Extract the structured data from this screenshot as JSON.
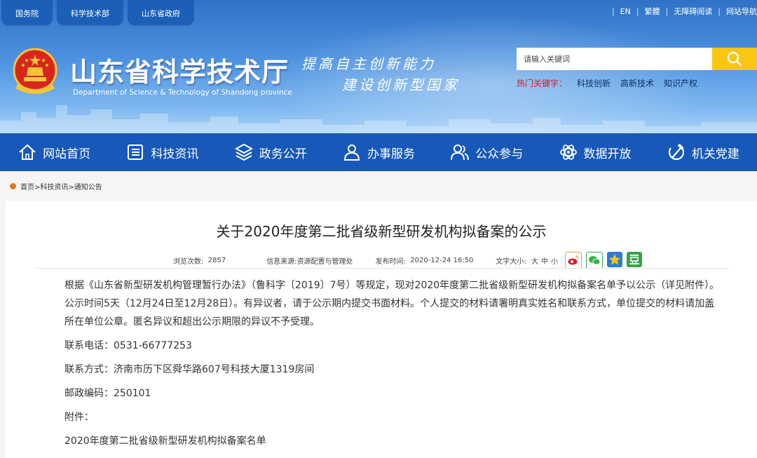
{
  "header": {
    "top_tabs": [
      "国务院",
      "科学技术部",
      "山东省政府"
    ],
    "util_links": [
      "EN",
      "繁體",
      "无障碍阅读",
      "网站导航"
    ],
    "site_title": "山东省科学技术厅",
    "site_subtitle": "Department of Science & Technology of Shandong province",
    "slogan_line1": "提高自主创新能力",
    "slogan_line2": "建设创新型国家",
    "search": {
      "placeholder": "请输入关键词"
    },
    "hot_label": "热门关键字：",
    "hot_keywords": [
      "科技创新",
      "高新技术",
      "知识产权"
    ]
  },
  "nav": [
    "网站首页",
    "科技资讯",
    "政务公开",
    "办事服务",
    "公众参与",
    "数据开放",
    "机关党建"
  ],
  "breadcrumb": [
    "首页",
    ">",
    "科技资讯",
    ">",
    "通知公告"
  ],
  "article": {
    "title": "关于2020年度第二批省级新型研发机构拟备案的公示",
    "views_label": "浏览次数:",
    "views": "2857",
    "source_label": "信息来源:",
    "source": "资源配置与管理处",
    "date_label": "发布时间:",
    "date": "2020-12-24 16:50",
    "size_label": "文字大小:",
    "sizes": [
      "大",
      "中",
      "小"
    ],
    "paragraph": "根据《山东省新型研发机构管理暂行办法》（鲁科字〔2019〕7号）等规定，现对2020年度第二批省级新型研发机构拟备案名单予以公示（详见附件）。公示时间5天（12月24日至12月28日）。有异议者，请于公示期内提交书面材料。个人提交的材料请署明真实姓名和联系方式，单位提交的材料请加盖所在单位公章。匿名异议和超出公示期限的异议不予受理。",
    "phone": "联系电话：0531-66777253",
    "address": "联系方式：济南市历下区舜华路607号科技大厦1319房间",
    "postcode": "邮政编码：250101",
    "attachment_label": "附件：",
    "attachment": "2020年度第二批省级新型研发机构拟备案名单"
  },
  "colors": {
    "nav_bg": "#1758b8",
    "search_button": "#f9c611",
    "hot_label": "#d61d1d"
  }
}
